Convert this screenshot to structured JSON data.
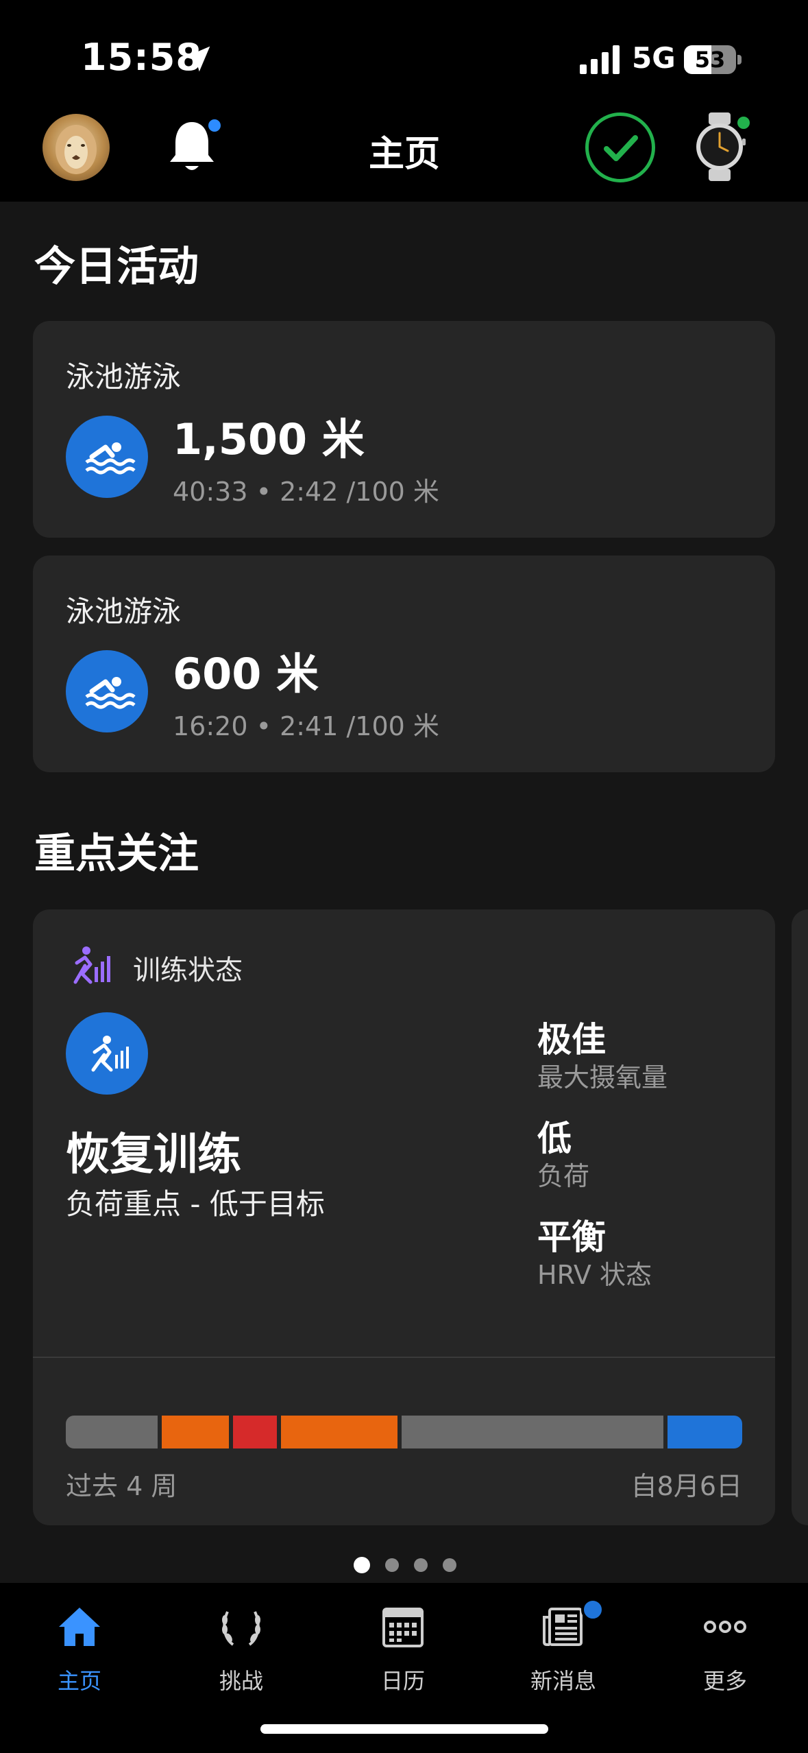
{
  "status_bar": {
    "time": "15:58",
    "network": "5G",
    "battery_level": 53,
    "battery_text": "53"
  },
  "header": {
    "title": "主页"
  },
  "today": {
    "section_title": "今日活动",
    "activities": [
      {
        "name": "泳池游泳",
        "distance": "1,500 米",
        "details": "40:33 • 2:42 /100 米"
      },
      {
        "name": "泳池游泳",
        "distance": "600 米",
        "details": "16:20 • 2:41 /100 米"
      }
    ]
  },
  "focus": {
    "section_title": "重点关注",
    "card": {
      "label": "训练状态",
      "status": "恢复训练",
      "description": "负荷重点 - 低于目标",
      "metrics": [
        {
          "value": "极佳",
          "label": "最大摄氧量"
        },
        {
          "value": "低",
          "label": "负荷"
        },
        {
          "value": "平衡",
          "label": "HRV 状态"
        }
      ],
      "bar_left_label": "过去 4 周",
      "bar_right_label": "自8月6日",
      "bar_colors": [
        "#6b6b6b",
        "#e8650f",
        "#d62a2a",
        "#e8650f",
        "#6b6b6b",
        "#1f74d9"
      ]
    },
    "page_count": 4,
    "active_page": 1
  },
  "tabbar": {
    "tabs": [
      {
        "label": "主页",
        "icon": "home-icon",
        "active": true
      },
      {
        "label": "挑战",
        "icon": "laurel-icon",
        "active": false
      },
      {
        "label": "日历",
        "icon": "calendar-icon",
        "active": false
      },
      {
        "label": "新消息",
        "icon": "news-icon",
        "active": false
      },
      {
        "label": "更多",
        "icon": "more-icon",
        "active": false
      }
    ]
  },
  "colors": {
    "accent_blue": "#1f74d9",
    "active_tab": "#3a93ff",
    "success_green": "#22b14c",
    "card_bg": "#262626",
    "page_bg": "#161616"
  }
}
